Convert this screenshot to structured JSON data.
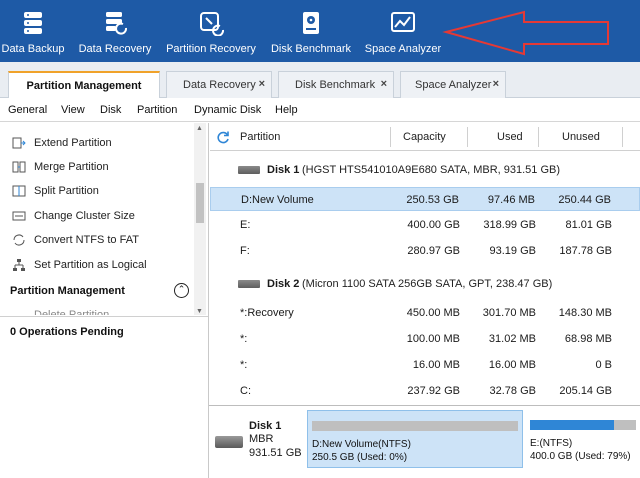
{
  "toolbar": {
    "items": [
      {
        "label": "Data Backup",
        "icon": "database-icon"
      },
      {
        "label": "Data Recovery",
        "icon": "data-recovery-icon"
      },
      {
        "label": "Partition Recovery",
        "icon": "partition-recovery-icon"
      },
      {
        "label": "Disk Benchmark",
        "icon": "disk-benchmark-icon"
      },
      {
        "label": "Space Analyzer",
        "icon": "space-analyzer-icon"
      }
    ],
    "annotation_arrow_color": "#e53935"
  },
  "tabs": [
    {
      "label": "Partition Management",
      "active": true
    },
    {
      "label": "Data Recovery",
      "close": "×"
    },
    {
      "label": "Disk Benchmark",
      "close": "×"
    },
    {
      "label": "Space Analyzer",
      "close": "×"
    }
  ],
  "menu": [
    "General",
    "View",
    "Disk",
    "Partition",
    "Dynamic Disk",
    "Help"
  ],
  "left_panel": {
    "operations": [
      {
        "label": "Extend Partition",
        "icon": "extend-partition-icon"
      },
      {
        "label": "Merge Partition",
        "icon": "merge-partition-icon"
      },
      {
        "label": "Split Partition",
        "icon": "split-partition-icon"
      },
      {
        "label": "Change Cluster Size",
        "icon": "cluster-size-icon"
      },
      {
        "label": "Convert NTFS to FAT",
        "icon": "convert-icon"
      },
      {
        "label": "Set Partition as Logical",
        "icon": "logical-partition-icon"
      }
    ],
    "section_title": "Partition Management",
    "partial_item": "Delete Partition",
    "pending": "0 Operations Pending"
  },
  "table": {
    "headers": {
      "partition": "Partition",
      "capacity": "Capacity",
      "used": "Used",
      "unused": "Unused"
    },
    "disks": [
      {
        "name": "Disk 1",
        "info": "(HGST HTS541010A9E680 SATA, MBR, 931.51 GB)",
        "partitions": [
          {
            "name": "D:New Volume",
            "capacity": "250.53 GB",
            "used": "97.46 MB",
            "unused": "250.44 GB",
            "selected": true
          },
          {
            "name": "E:",
            "capacity": "400.00 GB",
            "used": "318.99 GB",
            "unused": "81.01 GB"
          },
          {
            "name": "F:",
            "capacity": "280.97 GB",
            "used": "93.19 GB",
            "unused": "187.78 GB"
          }
        ]
      },
      {
        "name": "Disk 2",
        "info": "(Micron 1100 SATA 256GB SATA, GPT, 238.47 GB)",
        "partitions": [
          {
            "name": "*:Recovery",
            "capacity": "450.00 MB",
            "used": "301.70 MB",
            "unused": "148.30 MB"
          },
          {
            "name": "*:",
            "capacity": "100.00 MB",
            "used": "31.02 MB",
            "unused": "68.98 MB"
          },
          {
            "name": "*:",
            "capacity": "16.00 MB",
            "used": "16.00 MB",
            "unused": "0 B"
          },
          {
            "name": "C:",
            "capacity": "237.92 GB",
            "used": "32.78 GB",
            "unused": "205.14 GB"
          }
        ]
      }
    ]
  },
  "disk_map": {
    "disk_name": "Disk 1",
    "disk_type": "MBR",
    "disk_size": "931.51 GB",
    "partitions": [
      {
        "line1": "D:New Volume(NTFS)",
        "line2": "250.5 GB (Used: 0%)",
        "used_fraction": 0.0,
        "selected": true
      },
      {
        "line1": "E:(NTFS)",
        "line2": "400.0 GB (Used: 79%)",
        "used_fraction": 0.79
      }
    ]
  },
  "colors": {
    "toolbar_bg": "#1e5aa6",
    "selection": "#cde3f7",
    "accent_tab": "#f0a22a",
    "bar_blue": "#2f86d6"
  }
}
